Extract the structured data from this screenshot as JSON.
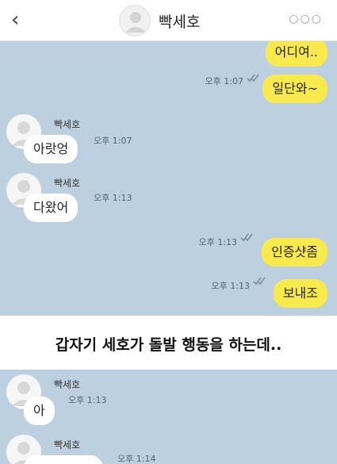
{
  "header": {
    "back_icon": "chevron-left-icon",
    "contact_name": "빡세호",
    "more_icon": "more-dots-icon"
  },
  "colors": {
    "chat_background": "#bcd0e0",
    "my_bubble": "#f8ea4c",
    "their_bubble": "#ffffff"
  },
  "messages_top": [
    {
      "side": "me",
      "text": "어디여..",
      "time": "",
      "read": false
    },
    {
      "side": "me",
      "text": "일단와~",
      "time": "오후 1:07",
      "read": true
    },
    {
      "side": "them",
      "sender": "빡세호",
      "text": "아랏엉",
      "time": "오후 1:07"
    },
    {
      "side": "them",
      "sender": "빡세호",
      "text": "다왔어",
      "time": "오후 1:13"
    },
    {
      "side": "me",
      "text": "인증샷좀",
      "time": "오후 1:13",
      "read": true
    },
    {
      "side": "me",
      "text": "보내조",
      "time": "오후 1:13",
      "read": true
    }
  ],
  "caption": "갑자기 세호가 돌발 행동을 하는데..",
  "messages_bottom": [
    {
      "side": "them",
      "sender": "빡세호",
      "text": "아",
      "time": "오후 1:13"
    },
    {
      "side": "them",
      "sender": "빡세호",
      "text": "",
      "time": "오후 1:14"
    }
  ]
}
